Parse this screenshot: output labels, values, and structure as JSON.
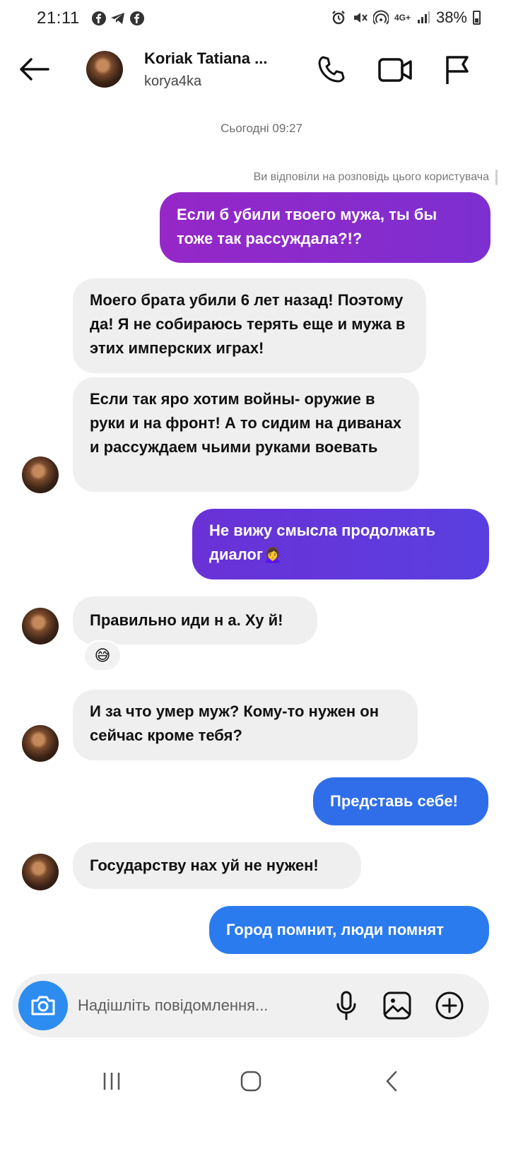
{
  "status_bar": {
    "time": "21:11",
    "network": "4G+",
    "battery": "38%",
    "app_icons": [
      "facebook-icon",
      "telegram-icon",
      "facebook-icon"
    ],
    "right_icons": [
      "alarm-icon",
      "mute-icon",
      "hotspot-icon",
      "signal-icon",
      "battery-icon"
    ]
  },
  "header": {
    "contact_name": "Koriak Tatiana ...",
    "username": "korya4ka",
    "icons": [
      "back-arrow-icon",
      "phone-icon",
      "video-camera-icon",
      "flag-icon"
    ]
  },
  "conversation": {
    "timestamp": "Сьогодні 09:27",
    "reply_notice": "Ви відповіли на розповідь цього користувача",
    "messages": [
      {
        "from": "me",
        "text": "Если б убили твоего мужа, ты бы тоже так рассуждала?!?"
      },
      {
        "from": "them",
        "text": "Моего брата убили 6 лет назад! Поэтому да! Я не собираюсь терять еще и мужа в этих имперских играх!"
      },
      {
        "from": "them",
        "text": "Если так яро хотим войны- оружие в руки и на фронт! А то сидим на диванах и рассуждаем чьими руками воевать"
      },
      {
        "from": "me",
        "text": "Не вижу смысла продолжать диалог🙍‍♀️"
      },
      {
        "from": "them",
        "text": "Правильно иди н а. Ху й!",
        "reaction": "😅"
      },
      {
        "from": "them",
        "text": "И за что умер муж? Кому-то нужен он сейчас кроме тебя?"
      },
      {
        "from": "me",
        "text": "Представь себе!"
      },
      {
        "from": "them",
        "text": "Государству нах уй не нужен!"
      },
      {
        "from": "me",
        "text": "Город помнит, люди помнят"
      }
    ]
  },
  "composer": {
    "placeholder": "Надішліть повідомлення...",
    "icons": [
      "camera-icon",
      "microphone-icon",
      "gallery-icon",
      "plus-icon"
    ]
  },
  "nav_bar": {
    "icons": [
      "recent-apps-icon",
      "home-icon",
      "back-icon"
    ]
  },
  "colors": {
    "sent_purple": "#8a2bcc",
    "sent_violet": "#6237db",
    "sent_blue": "#2f6ee8",
    "received_gray": "#efefef",
    "camera_blue": "#2d8cf0"
  }
}
